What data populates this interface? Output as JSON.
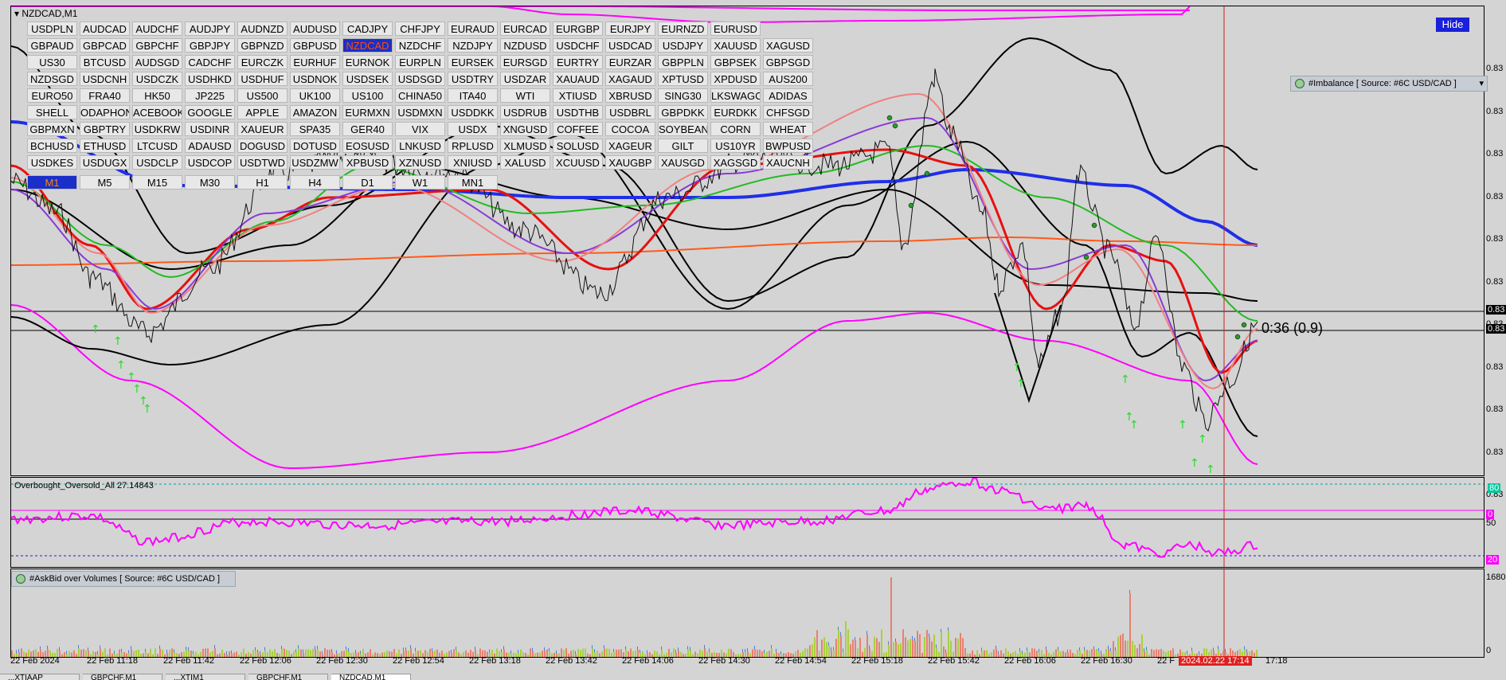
{
  "window": {
    "title": "NZDCAD,M1",
    "hide_label": "Hide"
  },
  "symbols": [
    [
      "USDPLN",
      "AUDCAD",
      "AUDCHF",
      "AUDJPY",
      "AUDNZD",
      "AUDUSD",
      "CADJPY",
      "CHFJPY",
      "EURAUD",
      "EURCAD",
      "EURGBP",
      "EURJPY",
      "EURNZD",
      "EURUSD"
    ],
    [
      "GBPAUD",
      "GBPCAD",
      "GBPCHF",
      "GBPJPY",
      "GBPNZD",
      "GBPUSD",
      "NZDCAD",
      "NZDCHF",
      "NZDJPY",
      "NZDUSD",
      "USDCHF",
      "USDCAD",
      "USDJPY",
      "XAUUSD",
      "XAGUSD"
    ],
    [
      "US30",
      "BTCUSD",
      "AUDSGD",
      "CADCHF",
      "EURCZK",
      "EURHUF",
      "EURNOK",
      "EURPLN",
      "EURSEK",
      "EURSGD",
      "EURTRY",
      "EURZAR",
      "GBPPLN",
      "GBPSEK",
      "GBPSGD"
    ],
    [
      "NZDSGD",
      "USDCNH",
      "USDCZK",
      "USDHKD",
      "USDHUF",
      "USDNOK",
      "USDSEK",
      "USDSGD",
      "USDTRY",
      "USDZAR",
      "XAUAUD",
      "XAGAUD",
      "XPTUSD",
      "XPDUSD",
      "AUS200"
    ],
    [
      "EURO50",
      "FRA40",
      "HK50",
      "JP225",
      "US500",
      "UK100",
      "US100",
      "CHINA50",
      "ITA40",
      "WTI",
      "XTIUSD",
      "XBRUSD",
      "SING30",
      "LKSWAGC",
      "ADIDAS"
    ],
    [
      "SHELL",
      "ODAPHON",
      "ACEBOOK",
      "GOOGLE",
      "APPLE",
      "AMAZON",
      "EURMXN",
      "USDMXN",
      "USDDKK",
      "USDRUB",
      "USDTHB",
      "USDBRL",
      "GBPDKK",
      "EURDKK",
      "CHFSGD"
    ],
    [
      "GBPMXN",
      "GBPTRY",
      "USDKRW",
      "USDINR",
      "XAUEUR",
      "SPA35",
      "GER40",
      "VIX",
      "USDX",
      "XNGUSD",
      "COFFEE",
      "COCOA",
      "SOYBEANS",
      "CORN",
      "WHEAT"
    ],
    [
      "BCHUSD",
      "ETHUSD",
      "LTCUSD",
      "ADAUSD",
      "DOGUSD",
      "DOTUSD",
      "EOSUSD",
      "LNKUSD",
      "RPLUSD",
      "XLMUSD",
      "SOLUSD",
      "XAGEUR",
      "GILT",
      "US10YR",
      "BWPUSD"
    ],
    [
      "USDKES",
      "USDUGX",
      "USDCLP",
      "USDCOP",
      "USDTWD",
      "USDZMW",
      "XPBUSD",
      "XZNUSD",
      "XNIUSD",
      "XALUSD",
      "XCUUSD",
      "XAUGBP",
      "XAUSGD",
      "XAGSGD",
      "XAUCNH"
    ]
  ],
  "active_symbol": "NZDCAD",
  "timeframes": [
    "M1",
    "M5",
    "M15",
    "M30",
    "H1",
    "H4",
    "D1",
    "W1",
    "MN1"
  ],
  "active_timeframe": "M1",
  "indicators": {
    "imbalance": "#Imbalance [ Source: #6C USD/CAD ]",
    "oscillator": "Overbought_Oversold_All 27.14843",
    "volumes": "#AskBid over Volumes [ Source: #6C USD/CAD ]"
  },
  "countdown": "0:36 (0.9)",
  "price_axis": [
    "0.83",
    "0.83",
    "0.83",
    "0.83",
    "0.83",
    "0.83",
    "0.83",
    "0.83",
    "0.83",
    "0.83",
    "0.83"
  ],
  "price_markers": [
    "0.83",
    "0.83"
  ],
  "osc_axis": {
    "top": "80",
    "mid_pink": "0",
    "mid": "50",
    "low": "20"
  },
  "vol_axis": {
    "top": "1680",
    "bottom": "0"
  },
  "time_axis": [
    "22 Feb 2024",
    "22 Feb 11:18",
    "22 Feb 11:42",
    "22 Feb 12:06",
    "22 Feb 12:30",
    "22 Feb 12:54",
    "22 Feb 13:18",
    "22 Feb 13:42",
    "22 Feb 14:06",
    "22 Feb 14:30",
    "22 Feb 14:54",
    "22 Feb 15:18",
    "22 Feb 15:42",
    "22 Feb 16:06",
    "22 Feb 16:30",
    "22 F",
    "17:18"
  ],
  "cursor_time": "2024.02.22 17:14",
  "tabs": [
    "...XTIAAP",
    "GBPCHF,M1",
    "...XTIM1",
    "GBPCHF,M1",
    "NZDCAD,M1"
  ],
  "colors": {
    "background": "#d4d4d4",
    "active_button": "#1a2fc8",
    "magenta": "#ff00ff",
    "blue_ma": "#1f2fe8",
    "orange_ma": "#ff5a1a",
    "red_ma": "#e81010",
    "green_ma": "#22bb22",
    "cursor_line": "#cc2020"
  }
}
